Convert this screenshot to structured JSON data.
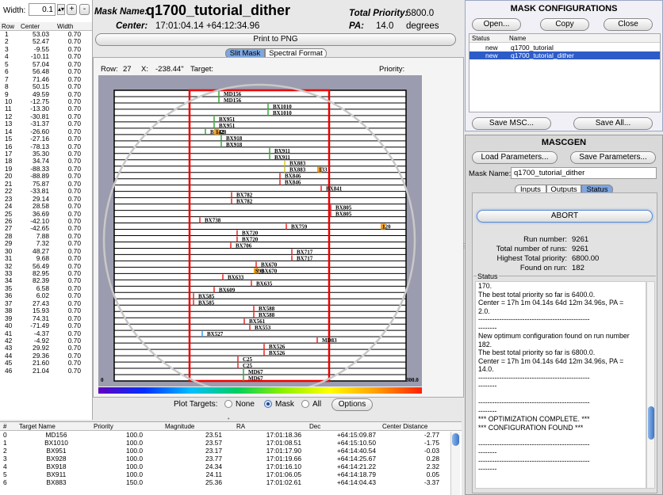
{
  "width_field": {
    "label": "Width:",
    "value": "0.1",
    "plus": "+",
    "minus": "-"
  },
  "left_table": {
    "headers": [
      "Row",
      "Center",
      "Width"
    ],
    "rows": [
      [
        "1",
        "53.03",
        "0.70"
      ],
      [
        "2",
        "52.47",
        "0.70"
      ],
      [
        "3",
        "-9.55",
        "0.70"
      ],
      [
        "4",
        "-10.11",
        "0.70"
      ],
      [
        "5",
        "57.04",
        "0.70"
      ],
      [
        "6",
        "56.48",
        "0.70"
      ],
      [
        "7",
        "71.46",
        "0.70"
      ],
      [
        "8",
        "50.15",
        "0.70"
      ],
      [
        "9",
        "49.59",
        "0.70"
      ],
      [
        "10",
        "-12.75",
        "0.70"
      ],
      [
        "11",
        "-13.30",
        "0.70"
      ],
      [
        "12",
        "-30.81",
        "0.70"
      ],
      [
        "13",
        "-31.37",
        "0.70"
      ],
      [
        "14",
        "-26.60",
        "0.70"
      ],
      [
        "15",
        "-27.16",
        "0.70"
      ],
      [
        "16",
        "-78.13",
        "0.70"
      ],
      [
        "17",
        "35.30",
        "0.70"
      ],
      [
        "18",
        "34.74",
        "0.70"
      ],
      [
        "19",
        "-88.33",
        "0.70"
      ],
      [
        "20",
        "-88.89",
        "0.70"
      ],
      [
        "21",
        "75.87",
        "0.70"
      ],
      [
        "22",
        "-33.81",
        "0.70"
      ],
      [
        "23",
        "29.14",
        "0.70"
      ],
      [
        "24",
        "28.58",
        "0.70"
      ],
      [
        "25",
        "36.69",
        "0.70"
      ],
      [
        "26",
        "-42.10",
        "0.70"
      ],
      [
        "27",
        "-42.65",
        "0.70"
      ],
      [
        "28",
        "7.88",
        "0.70"
      ],
      [
        "29",
        "7.32",
        "0.70"
      ],
      [
        "30",
        "48.27",
        "0.70"
      ],
      [
        "31",
        "9.68",
        "0.70"
      ],
      [
        "32",
        "56.49",
        "0.70"
      ],
      [
        "33",
        "82.95",
        "0.70"
      ],
      [
        "34",
        "82.39",
        "0.70"
      ],
      [
        "35",
        "6.58",
        "0.70"
      ],
      [
        "36",
        "6.02",
        "0.70"
      ],
      [
        "37",
        "27.43",
        "0.70"
      ],
      [
        "38",
        "15.93",
        "0.70"
      ],
      [
        "39",
        "74.31",
        "0.70"
      ],
      [
        "40",
        "-71.49",
        "0.70"
      ],
      [
        "41",
        "-4.37",
        "0.70"
      ],
      [
        "42",
        "-4.92",
        "0.70"
      ],
      [
        "43",
        "29.92",
        "0.70"
      ],
      [
        "44",
        "29.36",
        "0.70"
      ],
      [
        "45",
        "21.60",
        "0.70"
      ],
      [
        "46",
        "21.04",
        "0.70"
      ]
    ]
  },
  "header": {
    "mask_name_label": "Mask Name:",
    "mask_name": "q1700_tutorial_dither",
    "total_priority_label": "Total Priority:",
    "total_priority": "6800.0",
    "center_label": "Center:",
    "center": "17:01:04.14 +64:12:34.96",
    "pa_label": "PA:",
    "pa": "14.0",
    "pa_unit": "degrees"
  },
  "print_button": "Print to PNG",
  "view_tabs": [
    "Slit Mask",
    "Spectral Format"
  ],
  "status_line": {
    "row_label": "Row:",
    "row": "27",
    "x_label": "X:",
    "x": "-238.44\"",
    "target_label": "Target:",
    "priority_label": "Priority:"
  },
  "plot": {
    "axis_left": "0",
    "axis_right": "300.0",
    "slit_labels": [
      "MD156",
      "BX1010",
      "BX951",
      "BX928",
      "BX918",
      "BX911",
      "BX883",
      "BX846",
      "BX841",
      "BX782",
      "BX805",
      "BX738",
      "BX759",
      "BX720",
      "BX706",
      "BX717",
      "BX670",
      "BX633",
      "BX635",
      "BX609",
      "BX585",
      "BX588",
      "BX561",
      "BX553",
      "BX527",
      "MD83",
      "BX526",
      "C25",
      "MD67"
    ],
    "extra_labels": [
      "142",
      "133",
      "120",
      "S90"
    ]
  },
  "plot_targets": {
    "label": "Plot Targets:",
    "options": [
      "None",
      "Mask",
      "All"
    ],
    "selected": "Mask",
    "options_button": "Options"
  },
  "bottom_table": {
    "headers": [
      "#",
      "Target Name",
      "Priority",
      "Magnitude",
      "RA",
      "Dec",
      "Center Distance"
    ],
    "rows": [
      [
        "0",
        "MD156",
        "100.0",
        "23.51",
        "17:01:18.36",
        "+64:15:09.87",
        "-2.77"
      ],
      [
        "1",
        "BX1010",
        "100.0",
        "23.57",
        "17:01:08.51",
        "+64:15:10.50",
        "-1.75"
      ],
      [
        "2",
        "BX951",
        "100.0",
        "23.17",
        "17:01:17.90",
        "+64:14:40.54",
        "-0.03"
      ],
      [
        "3",
        "BX928",
        "100.0",
        "23.77",
        "17:01:19.66",
        "+64:14:25.67",
        "0.28"
      ],
      [
        "4",
        "BX918",
        "100.0",
        "24.34",
        "17:01:16.10",
        "+64:14:21.22",
        "2.32"
      ],
      [
        "5",
        "BX911",
        "100.0",
        "24.11",
        "17:01:06.05",
        "+64:14:18.79",
        "0.05"
      ],
      [
        "6",
        "BX883",
        "150.0",
        "25.36",
        "17:01:02.61",
        "+64:14:04.43",
        "-3.37"
      ]
    ]
  },
  "mask_config": {
    "title": "MASK CONFIGURATIONS",
    "buttons": [
      "Open...",
      "Copy",
      "Close"
    ],
    "headers": [
      "Status",
      "Name"
    ],
    "rows": [
      [
        "new",
        "q1700_tutorial"
      ],
      [
        "new",
        "q1700_tutorial_dither"
      ]
    ],
    "save_msc": "Save MSC...",
    "save_all": "Save All..."
  },
  "mascgen": {
    "title": "MASCGEN",
    "load_button": "Load Parameters...",
    "save_button": "Save Parameters...",
    "mask_name_label": "Mask Name:",
    "mask_name": "q1700_tutorial_dither",
    "tabs": [
      "Inputs",
      "Outputs",
      "Status"
    ],
    "abort": "ABORT",
    "stats": [
      {
        "label": "Run number:",
        "value": "9261"
      },
      {
        "label": "Total number of runs:",
        "value": "9261"
      },
      {
        "label": "Highest Total priority:",
        "value": "6800.00"
      },
      {
        "label": "Found on run:",
        "value": "182"
      }
    ],
    "status_label": "Status",
    "log": [
      "170.",
      "The best total priority so far is 6400.0.",
      "Center = 17h 1m 04.14s  64d 12m 34.96s, PA =",
      "2.0.",
      "------------------------------------------------",
      "--------",
      "New optimum configuration found on run number",
      "182.",
      "The best total priority so far is 6800.0.",
      "Center = 17h 1m 04.14s  64d 12m 34.96s, PA =",
      "14.0.",
      "------------------------------------------------",
      "--------",
      "",
      "------------------------------------------------",
      "--------",
      "*** OPTIMIZATION COMPLETE. ***",
      "*** CONFIGURATION FOUND ***",
      "",
      "------------------------------------------------",
      "--------",
      "------------------------------------------------",
      "--------"
    ]
  }
}
